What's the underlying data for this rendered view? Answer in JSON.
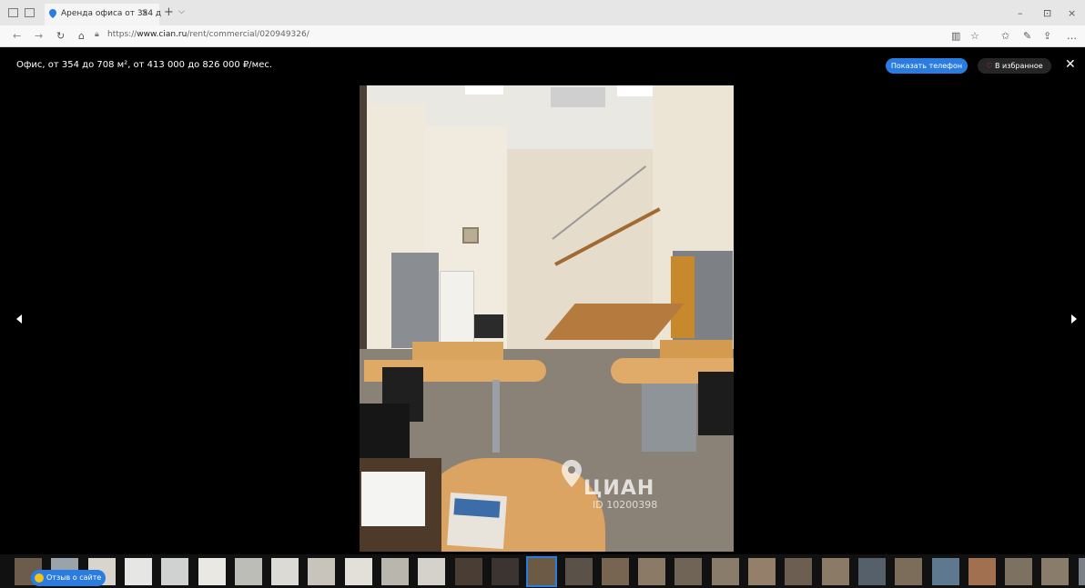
{
  "browser": {
    "tab_title": "Аренда офиса от 354 д",
    "tab_close": "×",
    "new_tab": "+",
    "tab_menu": "⌵",
    "url_prefix": "https://",
    "url_domain": "www.cian.ru",
    "url_path": "/rent/commercial/020949326/",
    "win_min": "–",
    "win_max": "⊡",
    "win_close": "×"
  },
  "gallery": {
    "headline": "Офис, от 354 до 708 м², от 413 000 до 826 000 ₽/мес.",
    "show_phone_label": "Показать телефон",
    "favorite_label": "В избранное",
    "watermark": "ЦИАН",
    "watermark_id": "ID 10200398",
    "feedback_label": "Отзыв о сайте",
    "thumbnail_count": 30,
    "selected_thumbnail": 14
  },
  "colors": {
    "accent": "#2a7ce0",
    "favorite_heart": "#e23a3a",
    "background": "#000000"
  }
}
